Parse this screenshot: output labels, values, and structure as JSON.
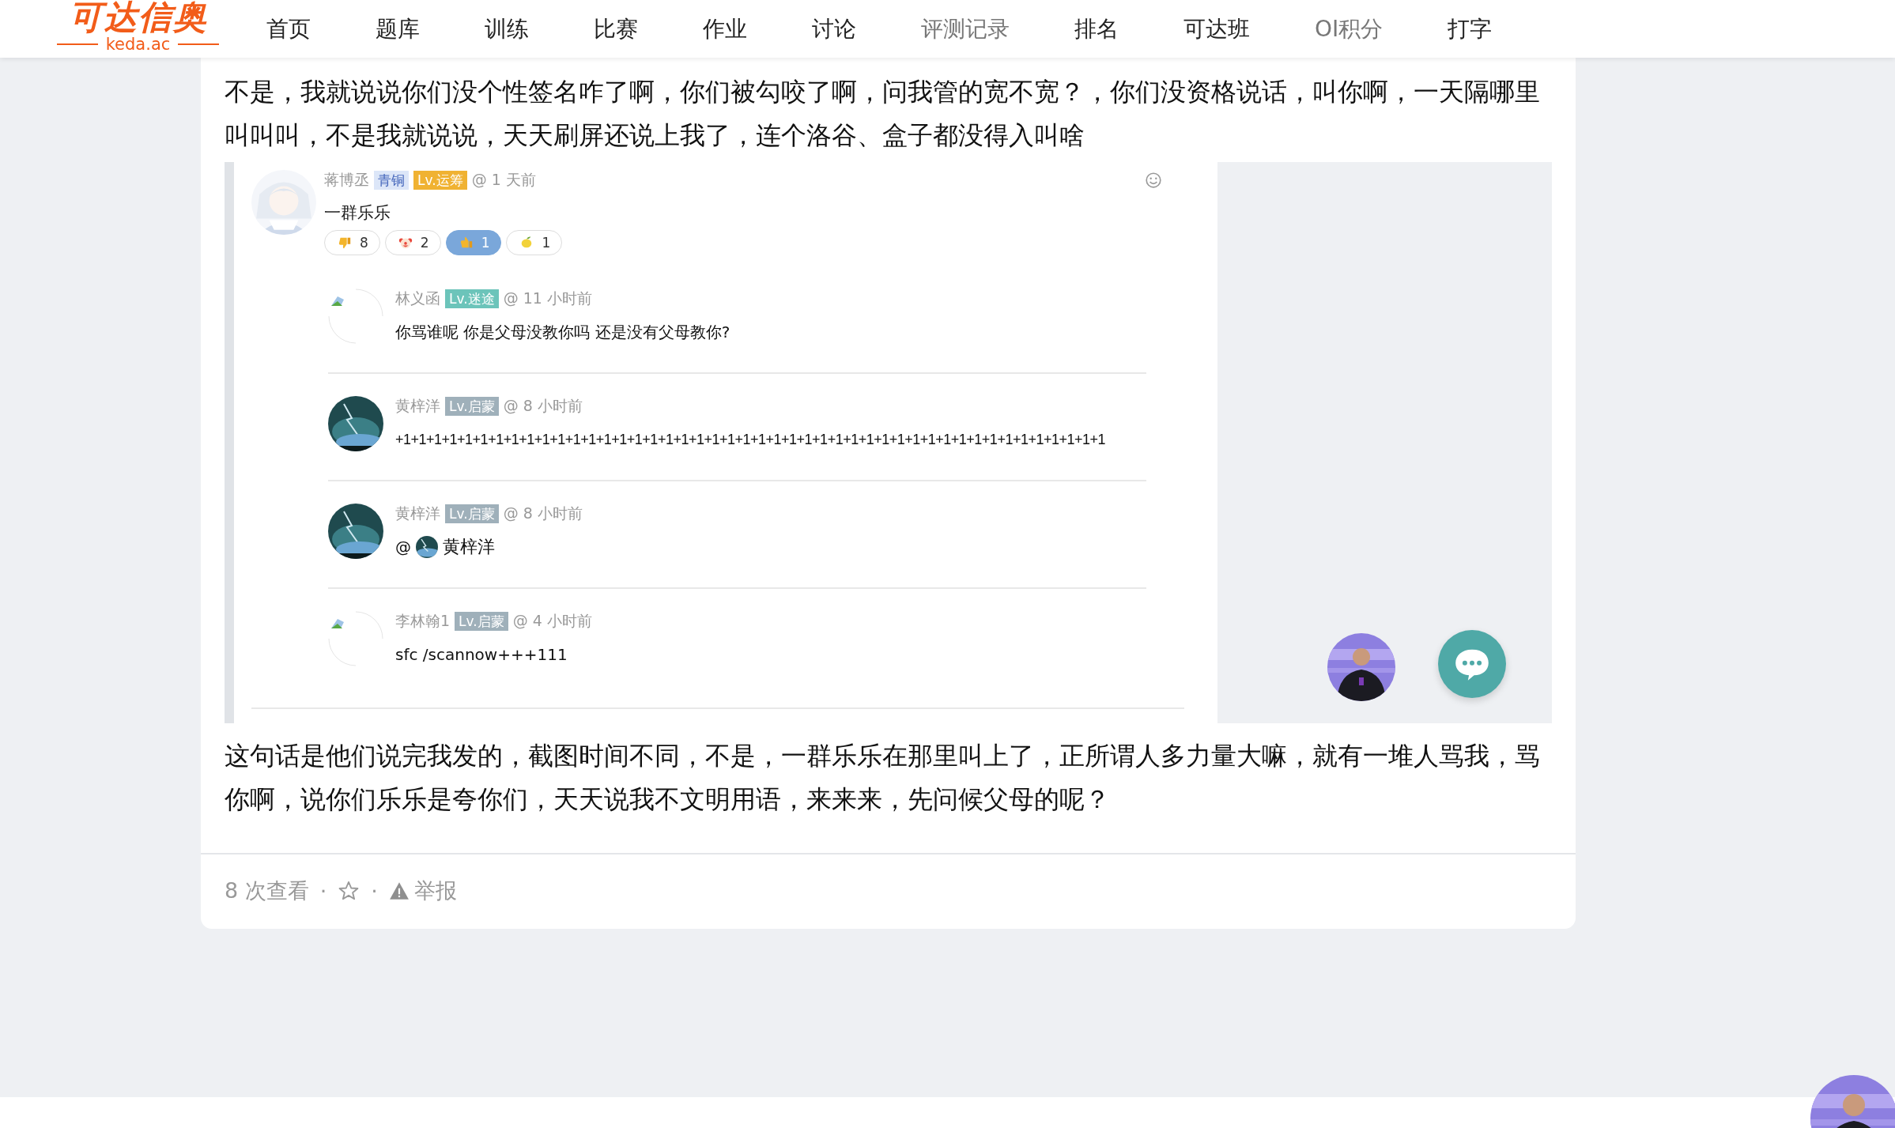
{
  "header": {
    "logo": {
      "title": "可达信奥",
      "subtitle": "keda.ac"
    },
    "nav": [
      {
        "label": "首页",
        "dimmed": false
      },
      {
        "label": "题库",
        "dimmed": false
      },
      {
        "label": "训练",
        "dimmed": false
      },
      {
        "label": "比赛",
        "dimmed": false
      },
      {
        "label": "作业",
        "dimmed": false
      },
      {
        "label": "讨论",
        "dimmed": false
      },
      {
        "label": "评测记录",
        "dimmed": true
      },
      {
        "label": "排名",
        "dimmed": false
      },
      {
        "label": "可达班",
        "dimmed": false
      },
      {
        "label": "OI积分",
        "dimmed": true
      },
      {
        "label": "打字",
        "dimmed": false
      }
    ]
  },
  "post": {
    "paragraphs_before": [
      "不是，我就说说你们没个性签名咋了啊，你们被勾咬了啊，问我管的宽不宽？，你们没资格说话，叫你啊，一天隔哪里叫叫叫，不是我就说说，天天刷屏还说上我了，连个洛谷、盒子都没得入叫啥"
    ],
    "screenshot": {
      "comment": {
        "author": "蒋博丞",
        "badges": [
          {
            "text": "青铜",
            "kind": "rank",
            "color": "#dce6f8"
          },
          {
            "text": "Lv.运筹",
            "kind": "level",
            "color": "#f0b232"
          }
        ],
        "time": "@ 1 天前",
        "content": "一群乐乐",
        "reactions": [
          {
            "kind": "thumbs-down",
            "count": "8",
            "selected": false
          },
          {
            "kind": "clown",
            "count": "2",
            "selected": false
          },
          {
            "kind": "thumbs-up",
            "count": "1",
            "selected": true
          },
          {
            "kind": "lemon",
            "count": "1",
            "selected": false
          }
        ]
      },
      "replies": [
        {
          "avatar": {
            "kind": "broken"
          },
          "author": "林义函",
          "badge": {
            "text": "Lv.迷途",
            "color": "#6cc4ba"
          },
          "time": "@ 11 小时前",
          "content": {
            "kind": "text",
            "text": "你骂谁呢 你是父母没教你吗 还是没有父母教你?"
          }
        },
        {
          "author": "黄梓洋",
          "badge": {
            "text": "Lv.启蒙",
            "color": "#9fb0ba"
          },
          "time": "@ 8 小时前",
          "content": {
            "kind": "text",
            "text": "+1+1+1+1+1+1+1+1+1+1+1+1+1+1+1+1+1+1+1+1+1+1+1+1+1+1+1+1+1+1+1+1+1+1+1+1+1+1+1+1+1+1+1+1+1+1"
          }
        },
        {
          "author": "黄梓洋",
          "badge": {
            "text": "Lv.启蒙",
            "color": "#9fb0ba"
          },
          "time": "@ 8 小时前",
          "content": {
            "kind": "mention",
            "prefix": "@",
            "name": "黄梓洋"
          }
        },
        {
          "avatar": {
            "kind": "broken"
          },
          "author": "李林翰1",
          "badge": {
            "text": "Lv.启蒙",
            "color": "#9fb0ba"
          },
          "time": "@ 4 小时前",
          "content": {
            "kind": "text",
            "text": "sfc /scannow+++111"
          }
        }
      ]
    },
    "paragraphs_after": [
      "这句话是他们说完我发的，截图时间不同，不是，一群乐乐在那里叫上了，正所谓人多力量大嘛，就有一堆人骂我，骂你啊，说你们乐乐是夸你们，天天说我不文明用语，来来来，先问候父母的呢？"
    ],
    "footer": {
      "views": "8 次查看",
      "separator": "·",
      "report": "举报"
    }
  }
}
